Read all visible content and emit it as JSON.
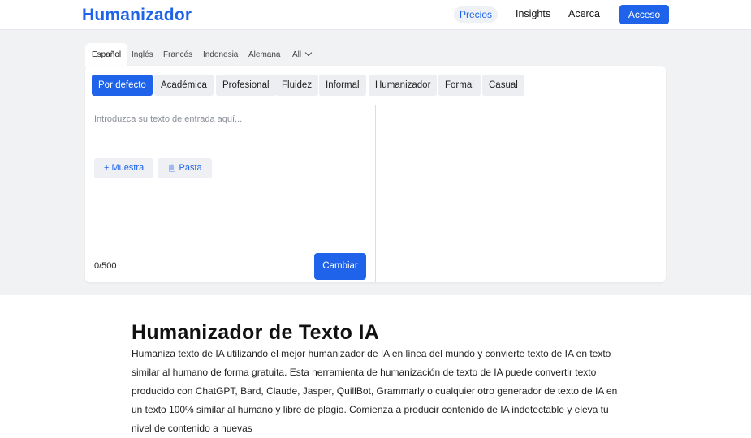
{
  "header": {
    "logo": "Humanizador",
    "nav": {
      "precios": "Precios",
      "insights": "Insights",
      "acerca": "Acerca",
      "acceso": "Acceso"
    }
  },
  "languages": {
    "items": [
      "Español",
      "Inglés",
      "Francés",
      "Indonesia",
      "Alemana"
    ],
    "all_label": "All",
    "selected": "Español"
  },
  "modes": {
    "items": [
      "Por defecto",
      "Académica",
      "Profesional",
      "Fluidez",
      "Informal",
      "Humanizador",
      "Formal",
      "Casual"
    ],
    "selected": "Por defecto"
  },
  "editor": {
    "placeholder": "Introduzca su texto de entrada aquí...",
    "sample_button": "+ Muestra",
    "paste_button": "Pasta",
    "char_count": "0/500",
    "submit_button": "Cambiar"
  },
  "article": {
    "title": "Humanizador de Texto IA",
    "body": "Humaniza texto de IA utilizando el mejor humanizador de IA en línea del mundo y convierte texto de IA en texto similar al humano de forma gratuita. Esta herramienta de humanización de texto de IA puede convertir texto producido con ChatGPT, Bard, Claude, Jasper, QuillBot, Grammarly o cualquier otro generador de texto de IA en un texto 100% similar al humano y libre de plagio. Comienza a producir contenido de IA indetectable y eleva tu nivel de contenido a nuevas"
  },
  "colors": {
    "accent": "#1e63e9",
    "background": "#f1f2f4"
  }
}
